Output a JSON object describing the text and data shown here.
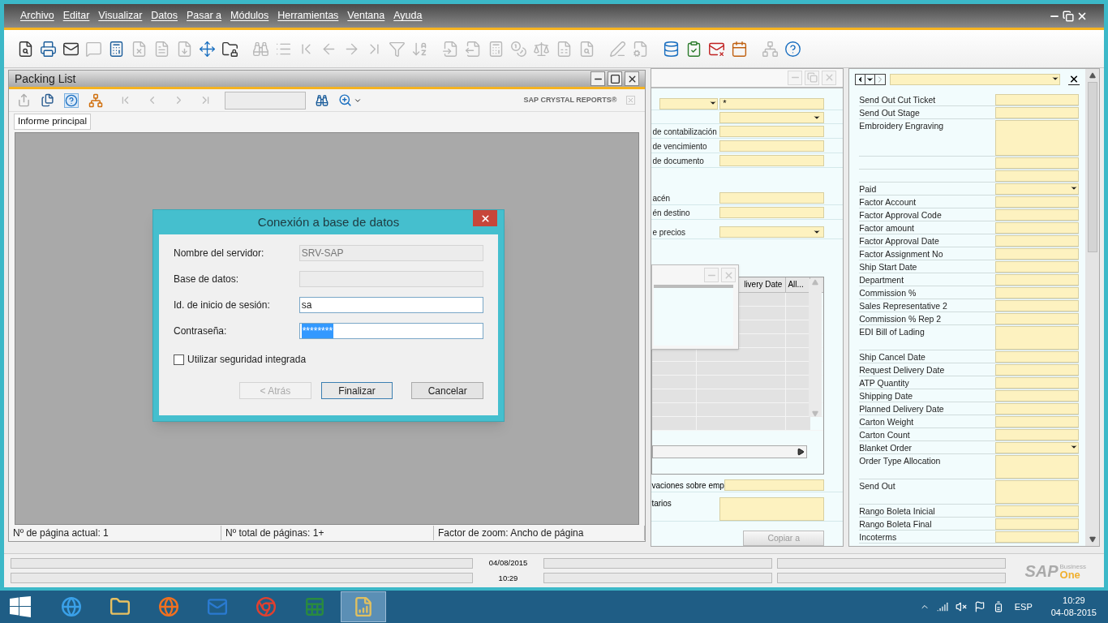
{
  "menu": [
    {
      "label": "Archivo"
    },
    {
      "label": "Editar"
    },
    {
      "label": "Visualizar"
    },
    {
      "label": "Datos"
    },
    {
      "label": "Pasar a"
    },
    {
      "label": "Módulos"
    },
    {
      "label": "Herramientas"
    },
    {
      "label": "Ventana"
    },
    {
      "label": "Ayuda"
    }
  ],
  "toolbar": [
    {
      "disabled": false
    },
    {
      "disabled": false
    },
    {
      "disabled": false
    },
    {
      "disabled": true
    },
    {
      "disabled": false
    },
    {
      "disabled": true
    },
    {
      "disabled": true
    },
    {
      "disabled": true
    },
    {
      "disabled": false
    },
    {
      "disabled": false
    },
    {
      "disabled": true
    },
    {
      "disabled": true
    },
    {
      "disabled": true
    },
    {
      "disabled": true
    },
    {
      "disabled": true
    },
    {
      "disabled": true
    },
    {
      "disabled": true
    },
    {
      "disabled": true
    },
    {
      "disabled": true
    },
    {
      "disabled": true
    },
    {
      "disabled": true
    },
    {
      "disabled": true
    },
    {
      "disabled": true
    },
    {
      "disabled": true
    },
    {
      "disabled": true
    },
    {
      "disabled": true
    },
    {
      "disabled": true
    },
    {
      "disabled": false
    },
    {
      "disabled": false
    },
    {
      "disabled": false
    },
    {
      "disabled": false
    },
    {
      "disabled": true
    },
    {
      "disabled": false
    }
  ],
  "packing_list": {
    "title": "Packing List",
    "brand": "SAP CRYSTAL REPORTS®",
    "tabs": [
      {
        "label": "Informe principal",
        "selected": true
      }
    ],
    "status": [
      "Nº de página actual: 1",
      "Nº total de páginas: 1+",
      "Factor de zoom: Ancho de página"
    ]
  },
  "dialog": {
    "title": "Conexión a base de datos",
    "fields": [
      {
        "label": "Nombre del servidor:",
        "value": "SRV-SAP",
        "disabled": true
      },
      {
        "label": "Base de datos:",
        "disabled": true
      },
      {
        "label": "Id. de inicio de sesión:",
        "value": "sa",
        "disabled": false
      },
      {
        "label": "Contraseña:",
        "value": "********",
        "disabled": false,
        "selected": true
      }
    ],
    "checkbox": {
      "label": "Utilizar seguridad integrada",
      "checked": false
    },
    "buttons": [
      {
        "label": "< Atrás",
        "disabled": true
      },
      {
        "label": "Finalizar",
        "disabled": false
      },
      {
        "label": "Cancelar",
        "disabled": false
      }
    ]
  },
  "document_form": {
    "fields": [
      {
        "kind": "series",
        "value": "*"
      },
      {
        "kind": "dropdown"
      },
      {
        "kind": "text",
        "label": "de contabilización"
      },
      {
        "kind": "text",
        "label": "de vencimiento"
      },
      {
        "kind": "text",
        "label": "de documento"
      },
      {
        "kind": "gap"
      },
      {
        "kind": "text",
        "label": "acén"
      },
      {
        "kind": "text",
        "label": "én destino"
      },
      {
        "kind": "dropdown",
        "label": "e precios"
      }
    ],
    "grid": {
      "columns": [
        "livery Date",
        "All..."
      ]
    },
    "bottom_fields": [
      {
        "kind": "text",
        "label": "vaciones sobre emp"
      },
      {
        "kind": "memo",
        "label": "tarios"
      }
    ],
    "copy_button": {
      "label": "Copiar a",
      "disabled": true
    }
  },
  "udf_panel": {
    "fields": [
      {
        "label": "Send Out Cut Ticket",
        "kind": "text"
      },
      {
        "label": "Send Out Stage",
        "kind": "text"
      },
      {
        "label": "Embroidery Engraving",
        "kind": "memo_large"
      },
      {
        "kind": "text"
      },
      {
        "kind": "text"
      },
      {
        "label": "Paid",
        "kind": "dropdown"
      },
      {
        "label": "Factor Account",
        "kind": "text"
      },
      {
        "label": "Factor Approval Code",
        "kind": "text"
      },
      {
        "label": "Factor amount",
        "kind": "text"
      },
      {
        "label": "Factor Approval Date",
        "kind": "text"
      },
      {
        "label": "Factor Assignment No",
        "kind": "text"
      },
      {
        "label": "Ship Start Date",
        "kind": "text"
      },
      {
        "label": "Department",
        "kind": "text"
      },
      {
        "label": "Commission %",
        "kind": "text"
      },
      {
        "label": "Sales Representative 2",
        "kind": "text"
      },
      {
        "label": "Commission % Rep 2",
        "kind": "text"
      },
      {
        "label": "EDI Bill of Lading",
        "kind": "memo"
      },
      {
        "label": "Ship Cancel Date",
        "kind": "text"
      },
      {
        "label": "Request Delivery Date",
        "kind": "text"
      },
      {
        "label": "ATP Quantity",
        "kind": "text"
      },
      {
        "label": "Shipping Date",
        "kind": "text"
      },
      {
        "label": "Planned Delivery Date",
        "kind": "text"
      },
      {
        "label": "Carton Weight",
        "kind": "text"
      },
      {
        "label": "Carton Count",
        "kind": "text"
      },
      {
        "label": "Blanket Order",
        "kind": "dropdown"
      },
      {
        "label": "Order Type Allocation",
        "kind": "memo"
      },
      {
        "label": "Send Out",
        "kind": "memo"
      },
      {
        "label": "Rango Boleta Inicial",
        "kind": "text"
      },
      {
        "label": "Rango Boleta Final",
        "kind": "text"
      },
      {
        "label": "Incoterms",
        "kind": "text"
      }
    ]
  },
  "status_bar": {
    "date": "04/08/2015",
    "time": "10:29"
  },
  "logo": {
    "brand": "SAP",
    "line1": "Business",
    "line2": "One"
  },
  "taskbar": {
    "apps": [
      {
        "selected": false
      },
      {
        "selected": false
      },
      {
        "selected": false
      },
      {
        "selected": false
      },
      {
        "selected": false
      },
      {
        "selected": false
      },
      {
        "selected": true
      }
    ],
    "language": "ESP",
    "time": "10:29",
    "date": "04-08-2015"
  }
}
